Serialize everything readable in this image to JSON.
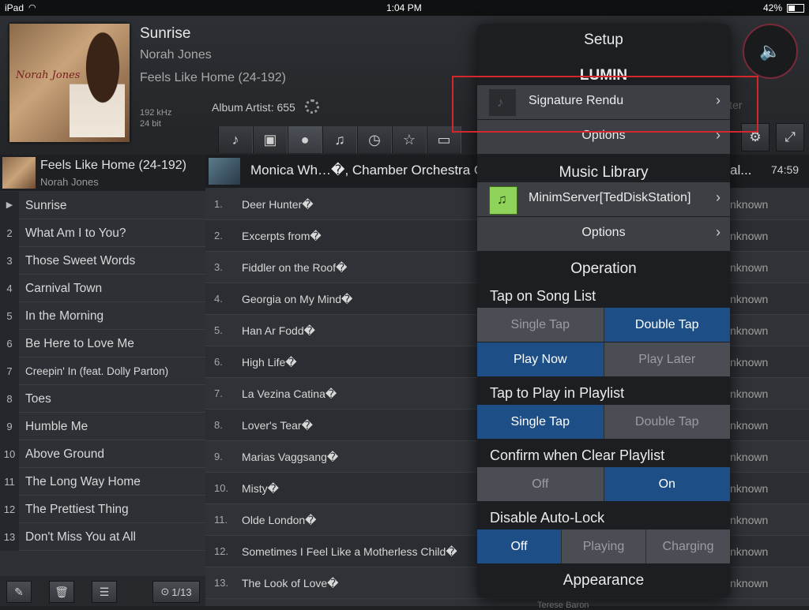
{
  "status_bar": {
    "device": "iPad",
    "time": "1:04 PM",
    "battery": "42%"
  },
  "now_playing": {
    "title": "Sunrise",
    "artist": "Norah Jones",
    "album": "Feels Like Home (24-192)",
    "sample_rate": "192 kHz",
    "bit_depth": "24 bit",
    "cover_text": "Norah Jones"
  },
  "library": {
    "album_artist": "Album Artist: 655",
    "filter_text": "lter",
    "toolbar_icons": [
      "note-icon",
      "album-icon",
      "artist-icon",
      "guitar-icon",
      "clock-icon",
      "star-icon",
      "folder-icon"
    ]
  },
  "playlist": {
    "current_album": "Feels Like Home (24-192)",
    "current_artist": "Norah Jones",
    "items": [
      {
        "num": "",
        "title": "Sunrise"
      },
      {
        "num": "2",
        "title": "What Am I to You?"
      },
      {
        "num": "3",
        "title": "Those Sweet Words"
      },
      {
        "num": "4",
        "title": "Carnival Town"
      },
      {
        "num": "5",
        "title": "In the Morning"
      },
      {
        "num": "6",
        "title": "Be Here to Love Me"
      },
      {
        "num": "7",
        "title": "Creepin' In (feat. Dolly Parton)"
      },
      {
        "num": "8",
        "title": "Toes"
      },
      {
        "num": "9",
        "title": "Humble Me"
      },
      {
        "num": "10",
        "title": "Above Ground"
      },
      {
        "num": "11",
        "title": "The Long Way Home"
      },
      {
        "num": "12",
        "title": "The Prettiest Thing"
      },
      {
        "num": "13",
        "title": "Don't Miss You at All"
      }
    ],
    "counter": "1/13"
  },
  "album_view": {
    "title": "Monica Wh…�, Chamber Orchestra C",
    "title_tail": "al...",
    "duration": "74:59",
    "songs": [
      {
        "num": "1.",
        "title": "Deer Hunter�",
        "right": "nknown"
      },
      {
        "num": "2.",
        "title": "Excerpts from�",
        "right": "nknown"
      },
      {
        "num": "3.",
        "title": "Fiddler on the Roof�",
        "right": "nknown"
      },
      {
        "num": "4.",
        "title": "Georgia on My Mind�",
        "right": "nknown"
      },
      {
        "num": "5.",
        "title": "Han Ar Fodd�",
        "right": "nknown"
      },
      {
        "num": "6.",
        "title": "High Life�",
        "right": "nknown"
      },
      {
        "num": "7.",
        "title": "La Vezina Catina�",
        "right": "nknown"
      },
      {
        "num": "8.",
        "title": "Lover's Tear�",
        "right": "nknown"
      },
      {
        "num": "9.",
        "title": "Marias Vaggsang�",
        "right": "nknown"
      },
      {
        "num": "10.",
        "title": "Misty�",
        "right": "nknown"
      },
      {
        "num": "11.",
        "title": "Olde London�",
        "right": "nknown"
      },
      {
        "num": "12.",
        "title": "Sometimes I Feel Like a Motherless Child�",
        "right": "nknown"
      },
      {
        "num": "13.",
        "title": "The Look of Love�",
        "right": "nknown"
      }
    ],
    "under_text": "Terese Baron"
  },
  "setup": {
    "title": "Setup",
    "lumin_title": "LUMIN",
    "renderer": "Signature Rendu",
    "options_label": "Options",
    "music_library_title": "Music Library",
    "server": "MinimServer[TedDiskStation]",
    "operation_title": "Operation",
    "tap_song_list": {
      "label": "Tap on Song List",
      "options": [
        "Single Tap",
        "Double Tap"
      ],
      "selected": "Double Tap"
    },
    "play_mode": {
      "options": [
        "Play Now",
        "Play Later"
      ],
      "selected": "Play Now"
    },
    "tap_playlist": {
      "label": "Tap to Play in Playlist",
      "options": [
        "Single Tap",
        "Double Tap"
      ],
      "selected": "Single Tap"
    },
    "confirm_clear": {
      "label": "Confirm when Clear Playlist",
      "options": [
        "Off",
        "On"
      ],
      "selected": "On"
    },
    "auto_lock": {
      "label": "Disable Auto-Lock",
      "options": [
        "Off",
        "Playing",
        "Charging"
      ],
      "selected": "Off"
    },
    "appearance_title": "Appearance"
  },
  "colors": {
    "accent": "#1d4f86",
    "highlight": "#d3262d"
  }
}
